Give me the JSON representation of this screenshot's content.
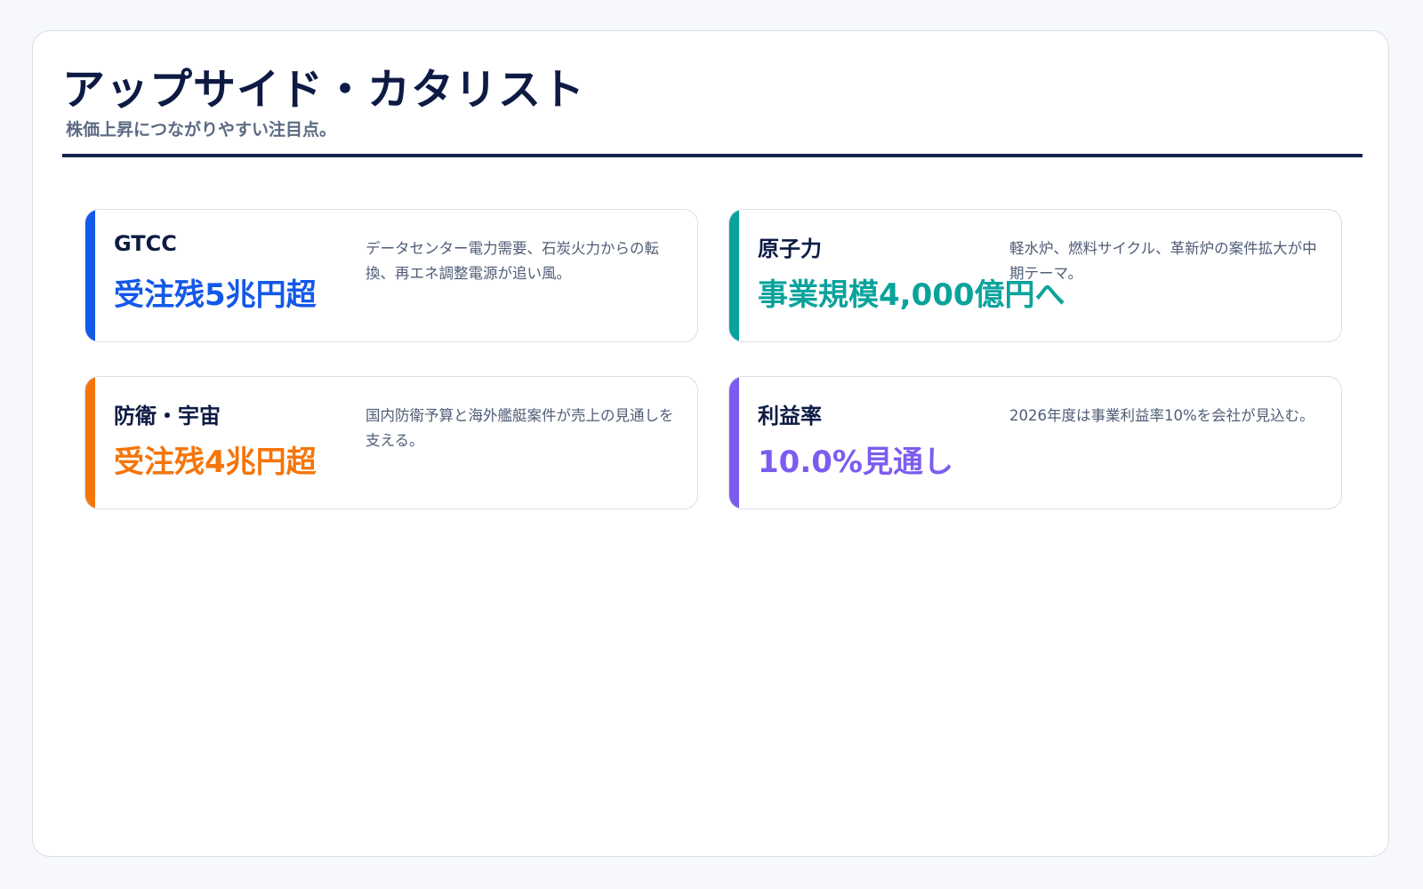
{
  "header": {
    "title": "アップサイド・カタリスト",
    "subtitle": "株価上昇につながりやすい注目点。"
  },
  "cards": [
    {
      "label": "GTCC",
      "metric": "受注残5兆円超",
      "description": "データセンター電力需要、石炭火力からの転換、再エネ調整電源が追い風。",
      "accent": "#1358e8"
    },
    {
      "label": "原子力",
      "metric": "事業規模4,000億円へ",
      "description": "軽水炉、燃料サイクル、革新炉の案件拡大が中期テーマ。",
      "accent": "#0aa39c"
    },
    {
      "label": "防衛・宇宙",
      "metric": "受注残4兆円超",
      "description": "国内防衛予算と海外艦艇案件が売上の見通しを支える。",
      "accent": "#f5750a"
    },
    {
      "label": "利益率",
      "metric": "10.0%見通し",
      "description": "2026年度は事業利益率10%を会社が見込む。",
      "accent": "#7c5cf0"
    }
  ]
}
